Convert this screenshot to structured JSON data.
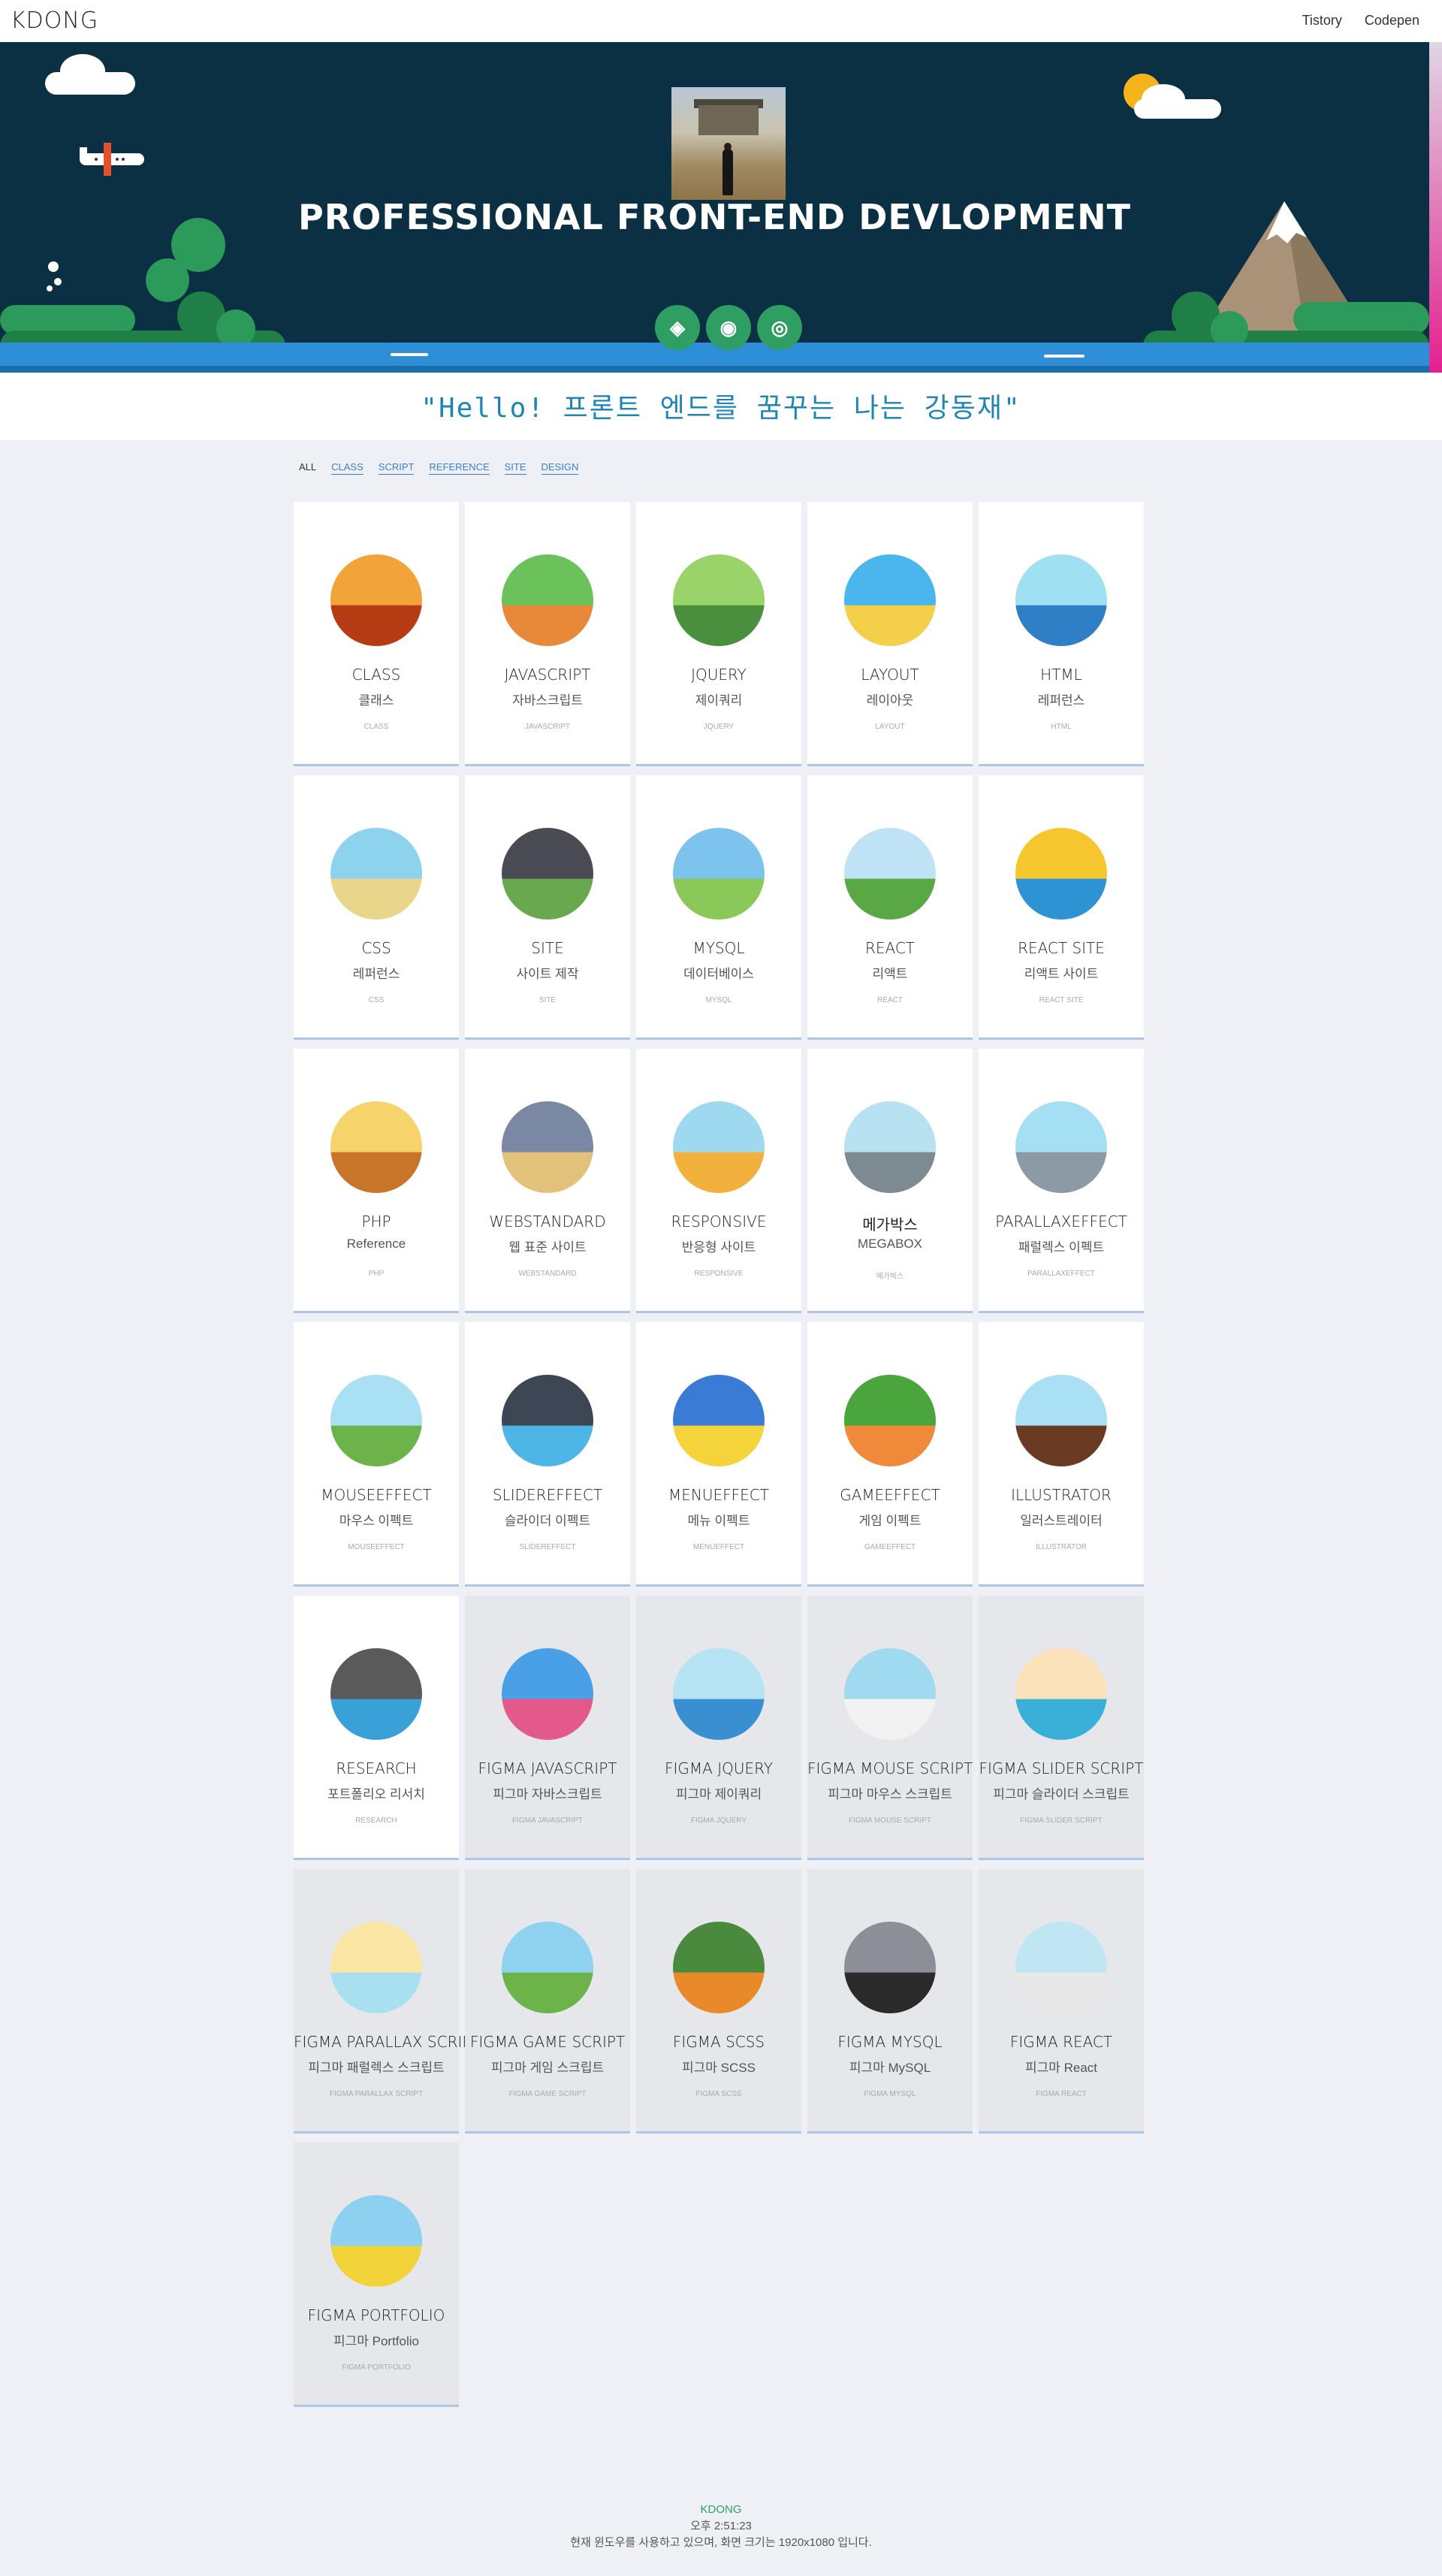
{
  "header": {
    "logo": "KDONG",
    "nav": [
      "Tistory",
      "Codepen"
    ]
  },
  "hero": {
    "title": "PROFESSIONAL FRONT-END DEVLOPMENT",
    "social": [
      {
        "icon": "codepen-icon",
        "glyph": "◈"
      },
      {
        "icon": "github-icon",
        "glyph": "◉"
      },
      {
        "icon": "instagram-icon",
        "glyph": "◎"
      }
    ],
    "colors": {
      "bg": "#0b2f43",
      "accent": "#2e9e63",
      "water": "#2e8fd6"
    }
  },
  "quote": "\"Hello! 프론트 엔드를 꿈꾸는 나는 강동재\"",
  "filters": {
    "active": "ALL",
    "links": [
      "CLASS",
      "SCRIPT",
      "REFERENCE",
      "SITE",
      "DESIGN"
    ]
  },
  "cards": [
    {
      "title": "CLASS",
      "sub": "클래스",
      "tag": "CLASS",
      "figma": false,
      "c1": "#f2a33a",
      "c2": "#b43b12"
    },
    {
      "title": "JAVASCRIPT",
      "sub": "자바스크립트",
      "tag": "JAVASCRIPT",
      "figma": false,
      "c1": "#6bc25a",
      "c2": "#e8893a"
    },
    {
      "title": "JQUERY",
      "sub": "제이쿼리",
      "tag": "JQUERY",
      "figma": false,
      "c1": "#9ad36a",
      "c2": "#4a8f3e"
    },
    {
      "title": "LAYOUT",
      "sub": "레이아웃",
      "tag": "LAYOUT",
      "figma": false,
      "c1": "#4bb6ee",
      "c2": "#f3cf4a"
    },
    {
      "title": "HTML",
      "sub": "레퍼런스",
      "tag": "HTML",
      "figma": false,
      "c1": "#9fe0f2",
      "c2": "#2f7fc7"
    },
    {
      "title": "CSS",
      "sub": "레퍼런스",
      "tag": "CSS",
      "figma": false,
      "c1": "#8ed3ee",
      "c2": "#e9d68a"
    },
    {
      "title": "SITE",
      "sub": "사이트 제작",
      "tag": "SITE",
      "figma": false,
      "c1": "#4a4a55",
      "c2": "#6aa84f"
    },
    {
      "title": "MYSQL",
      "sub": "데이터베이스",
      "tag": "MYSQL",
      "figma": false,
      "c1": "#7cc3ee",
      "c2": "#8ac85a"
    },
    {
      "title": "REACT",
      "sub": "리액트",
      "tag": "REACT",
      "figma": false,
      "c1": "#bfe3f5",
      "c2": "#5aa845"
    },
    {
      "title": "REACT SITE",
      "sub": "리액트 사이트",
      "tag": "REACT SITE",
      "figma": false,
      "c1": "#f6c62f",
      "c2": "#2e93d3"
    },
    {
      "title": "PHP",
      "sub": "Reference",
      "tag": "PHP",
      "figma": false,
      "c1": "#f7d36b",
      "c2": "#c8752a"
    },
    {
      "title": "WEBSTANDARD",
      "sub": "웹 표준 사이트",
      "tag": "WEBSTANDARD",
      "figma": false,
      "c1": "#7a88a3",
      "c2": "#e2c27a"
    },
    {
      "title": "RESPONSIVE",
      "sub": "반응형 사이트",
      "tag": "RESPONSIVE",
      "figma": false,
      "c1": "#9fd9ef",
      "c2": "#f2b03d"
    },
    {
      "title": "메가박스",
      "sub": "MEGABOX",
      "tag": "메가박스",
      "figma": false,
      "c1": "#b8e2f2",
      "c2": "#7d8a92"
    },
    {
      "title": "PARALLAXEFFECT",
      "sub": "패럴렉스 이펙트",
      "tag": "PARALLAXEFFECT",
      "figma": false,
      "c1": "#a5dff3",
      "c2": "#8c9aa6"
    },
    {
      "title": "MOUSEEFFECT",
      "sub": "마우스 이펙트",
      "tag": "MOUSEEFFECT",
      "figma": false,
      "c1": "#a9e0f4",
      "c2": "#6cb34a"
    },
    {
      "title": "SLIDEREFFECT",
      "sub": "슬라이더 이펙트",
      "tag": "SLIDEREFFECT",
      "figma": false,
      "c1": "#3d4654",
      "c2": "#4db6e6"
    },
    {
      "title": "MENUEFFECT",
      "sub": "메뉴 이펙트",
      "tag": "MENUEFFECT",
      "figma": false,
      "c1": "#3a7bd5",
      "c2": "#f5d33a"
    },
    {
      "title": "GAMEEFFECT",
      "sub": "게임 이펙트",
      "tag": "GAMEEFFECT",
      "figma": false,
      "c1": "#4aa63c",
      "c2": "#f08a3a"
    },
    {
      "title": "ILLUSTRATOR",
      "sub": "일러스트레이터",
      "tag": "ILLUSTRATOR",
      "figma": false,
      "c1": "#a9e0f4",
      "c2": "#6a3a22"
    },
    {
      "title": "RESEARCH",
      "sub": "포트폴리오 리서치",
      "tag": "RESEARCH",
      "figma": false,
      "c1": "#5a5a5a",
      "c2": "#3aa0d8"
    },
    {
      "title": "FIGMA JAVASCRIPT",
      "sub": "피그마 자바스크립트",
      "tag": "FIGMA JAVASCRIPT",
      "figma": true,
      "c1": "#4aa0e6",
      "c2": "#e35a8a"
    },
    {
      "title": "FIGMA JQUERY",
      "sub": "피그마 제이쿼리",
      "tag": "FIGMA JQUERY",
      "figma": true,
      "c1": "#b6e4f4",
      "c2": "#3a8fd0"
    },
    {
      "title": "FIGMA MOUSE SCRIPT",
      "sub": "피그마 마우스 스크립트",
      "tag": "FIGMA MOUSE SCRIPT",
      "figma": true,
      "c1": "#9fdaf0",
      "c2": "#f2f2f2"
    },
    {
      "title": "FIGMA SLIDER SCRIPT",
      "sub": "피그마 슬라이더 스크립트",
      "tag": "FIGMA SLIDER SCRIPT",
      "figma": true,
      "c1": "#fbe2bb",
      "c2": "#3ab0d8"
    },
    {
      "title": "FIGMA PARALLAX SCRIPT",
      "sub": "피그마 패럴렉스 스크립트",
      "tag": "FIGMA PARALLAX SCRIPT",
      "figma": true,
      "c1": "#fbe6a5",
      "c2": "#a9e0ef"
    },
    {
      "title": "FIGMA GAME SCRIPT",
      "sub": "피그마 게임 스크립트",
      "tag": "FIGMA GAME SCRIPT",
      "figma": true,
      "c1": "#8fd2f0",
      "c2": "#6cb34a"
    },
    {
      "title": "FIGMA SCSS",
      "sub": "피그마 SCSS",
      "tag": "FIGMA SCSS",
      "figma": true,
      "c1": "#4a8a3e",
      "c2": "#e88a2a"
    },
    {
      "title": "FIGMA MYSQL",
      "sub": "피그마 MySQL",
      "tag": "FIGMA MYSQL",
      "figma": true,
      "c1": "#8e8e98",
      "c2": "#2a2a2a"
    },
    {
      "title": "FIGMA REACT",
      "sub": "피그마 React",
      "tag": "FIGMA REACT",
      "figma": true,
      "c1": "#bfe6f2",
      "c2": "#e8e8e8"
    },
    {
      "title": "FIGMA PORTFOLIO",
      "sub": "피그마 Portfolio",
      "tag": "FIGMA PORTFOLIO",
      "figma": true,
      "c1": "#8ed0ef",
      "c2": "#f2d33a"
    }
  ],
  "footer": {
    "brand": "KDONG",
    "time": "오후 2:51:23",
    "note": "현재 윈도우를 사용하고 있으며, 화면 크기는 1920x1080 입니다."
  }
}
